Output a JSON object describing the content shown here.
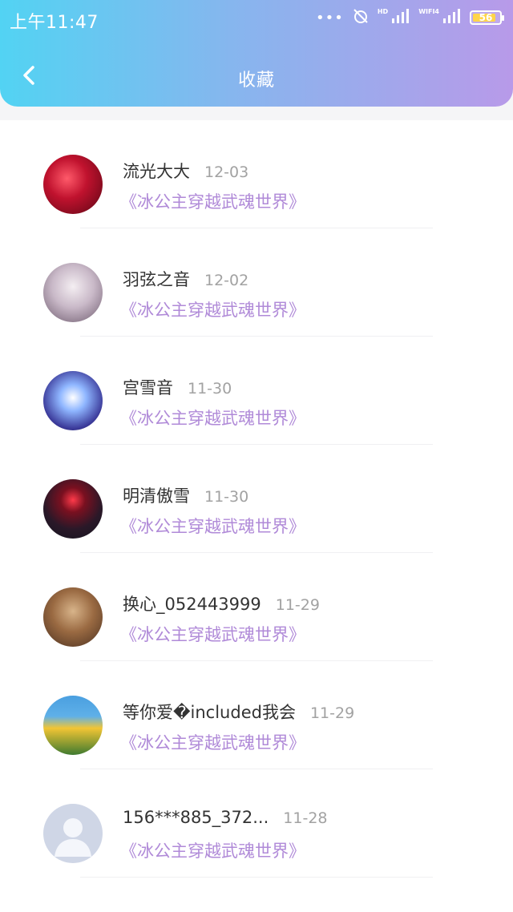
{
  "status_bar": {
    "time": "上午11:47",
    "signal_labels": [
      "HD",
      "WIFI4"
    ],
    "battery": "56"
  },
  "navbar": {
    "title": "收藏"
  },
  "favorites": [
    {
      "name": "流光大大",
      "date": "12-03",
      "book": "《冰公主穿越武魂世界》"
    },
    {
      "name": "羽弦之音",
      "date": "12-02",
      "book": "《冰公主穿越武魂世界》"
    },
    {
      "name": "宫雪音",
      "date": "11-30",
      "book": "《冰公主穿越武魂世界》"
    },
    {
      "name": "明清傲雪",
      "date": "11-30",
      "book": "《冰公主穿越武魂世界》"
    },
    {
      "name": "换心_052443999",
      "date": "11-29",
      "book": "《冰公主穿越武魂世界》"
    },
    {
      "name": "等你爱�included我会",
      "date": "11-29",
      "book": "《冰公主穿越武魂世界》"
    },
    {
      "name": "156***885_372...",
      "date": "11-28",
      "book": "《冰公主穿越武魂世界》"
    }
  ],
  "colors": {
    "header_start": "#52d3f3",
    "header_end": "#b89ae9",
    "book_title": "#b08ad8",
    "date": "#a2a2a2"
  }
}
